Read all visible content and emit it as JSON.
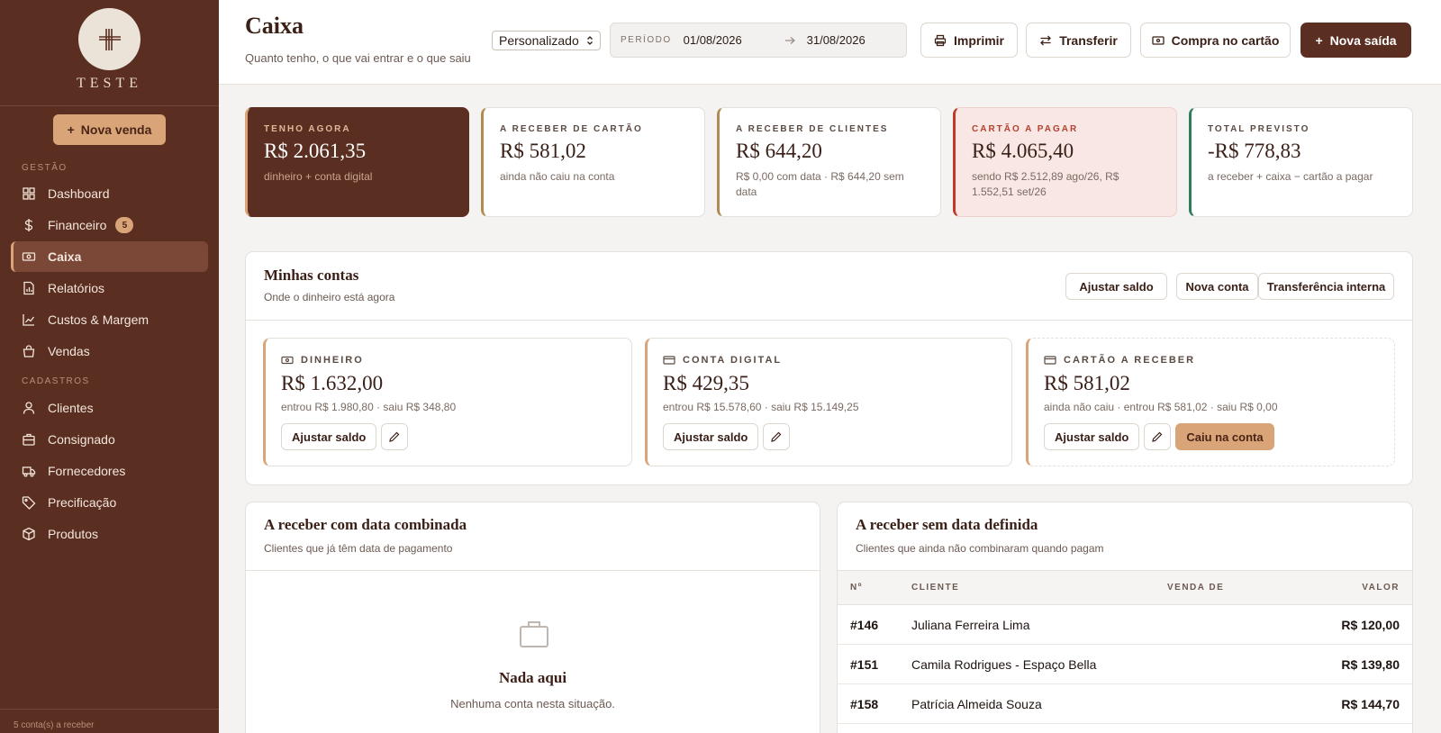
{
  "brand": {
    "name": "TESTE"
  },
  "sidebar": {
    "new_sale_label": "Nova venda",
    "sections": {
      "gestao": "GESTÃO",
      "cadastros": "CADASTROS"
    },
    "items": [
      {
        "label": "Dashboard",
        "icon": "dashboard-icon"
      },
      {
        "label": "Financeiro",
        "icon": "dollar-icon",
        "badge": "5"
      },
      {
        "label": "Caixa",
        "icon": "cash-icon",
        "active": true
      },
      {
        "label": "Relatórios",
        "icon": "report-icon"
      },
      {
        "label": "Custos & Margem",
        "icon": "chart-line-icon"
      },
      {
        "label": "Vendas",
        "icon": "bag-icon"
      },
      {
        "label": "Clientes",
        "icon": "user-icon"
      },
      {
        "label": "Consignado",
        "icon": "briefcase-icon"
      },
      {
        "label": "Fornecedores",
        "icon": "truck-icon"
      },
      {
        "label": "Precificação",
        "icon": "tag-icon"
      },
      {
        "label": "Produtos",
        "icon": "box-icon"
      }
    ],
    "footer": "5 conta(s) a receber"
  },
  "header": {
    "title": "Caixa",
    "subtitle": "Quanto tenho, o que vai entrar e o que saiu",
    "period_select": "Personalizado",
    "period_label": "PERÍODO",
    "period_start": "01/08/2026",
    "period_end": "31/08/2026",
    "buttons": {
      "print": "Imprimir",
      "transfer": "Transferir",
      "card_purchase": "Compra no cartão",
      "new_exit": "Nova saída"
    }
  },
  "summary": [
    {
      "label": "TENHO AGORA",
      "value": "R$ 2.061,35",
      "note": "dinheiro + conta digital"
    },
    {
      "label": "A RECEBER DE CARTÃO",
      "value": "R$ 581,02",
      "note": "ainda não caiu na conta"
    },
    {
      "label": "A RECEBER DE CLIENTES",
      "value": "R$ 644,20",
      "note": "R$ 0,00 com data · R$ 644,20 sem data"
    },
    {
      "label": "CARTÃO A PAGAR",
      "value": "R$ 4.065,40",
      "note": "sendo R$ 2.512,89 ago/26, R$ 1.552,51 set/26"
    },
    {
      "label": "TOTAL PREVISTO",
      "value": "-R$ 778,83",
      "note": "a receber + caixa − cartão a pagar"
    }
  ],
  "accounts": {
    "title": "Minhas contas",
    "subtitle": "Onde o dinheiro está agora",
    "buttons": {
      "adjust": "Ajustar saldo",
      "new": "Nova conta",
      "internal_transfer": "Transferência interna"
    },
    "items": [
      {
        "label": "DINHEIRO",
        "value": "R$ 1.632,00",
        "note": "entrou R$ 1.980,80 · saiu R$ 348,80",
        "adjust": "Ajustar saldo"
      },
      {
        "label": "CONTA DIGITAL",
        "value": "R$ 429,35",
        "note": "entrou R$ 15.578,60 · saiu R$ 15.149,25",
        "adjust": "Ajustar saldo"
      },
      {
        "label": "CARTÃO A RECEBER",
        "value": "R$ 581,02",
        "note": "ainda não caiu · entrou R$ 581,02 · saiu R$ 0,00",
        "adjust": "Ajustar saldo",
        "action": "Caiu na conta"
      }
    ]
  },
  "receivable_dated": {
    "title": "A receber com data combinada",
    "subtitle": "Clientes que já têm data de pagamento",
    "empty_title": "Nada aqui",
    "empty_sub": "Nenhuma conta nesta situação."
  },
  "receivable_undated": {
    "title": "A receber sem data definida",
    "subtitle": "Clientes que ainda não combinaram quando pagam",
    "columns": [
      "Nº",
      "CLIENTE",
      "VENDA DE",
      "VALOR"
    ],
    "rows": [
      {
        "num": "#146",
        "client": "Juliana Ferreira Lima",
        "sale": "",
        "value": "R$ 120,00"
      },
      {
        "num": "#151",
        "client": "Camila Rodrigues - Espaço Bella",
        "sale": "",
        "value": "R$ 139,80"
      },
      {
        "num": "#158",
        "client": "Patrícia Almeida Souza",
        "sale": "",
        "value": "R$ 144,70"
      }
    ]
  },
  "colors": {
    "sidebar": "#5a2e20",
    "accent": "#d9a478",
    "danger_bg": "#f8e7e4",
    "positive": "#2e7d5b"
  }
}
